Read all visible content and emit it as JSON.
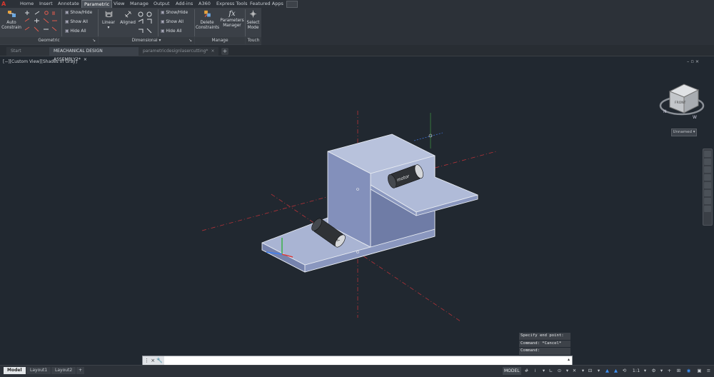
{
  "menu": {
    "logo": "A",
    "tabs": [
      "Home",
      "Insert",
      "Annotate",
      "Parametric",
      "View",
      "Manage",
      "Output",
      "Add-ins",
      "A360",
      "Express Tools",
      "Featured Apps"
    ],
    "active_tab": "Parametric"
  },
  "ribbon": {
    "geometric": {
      "auto_constrain_line1": "Auto",
      "auto_constrain_line2": "Constrain",
      "show_hide": "Show/Hide",
      "show_all": "Show All",
      "hide_all": "Hide All",
      "panel_label": "Geometric"
    },
    "dimensional": {
      "linear": "Linear",
      "aligned": "Aligned",
      "show_hide": "Show/Hide",
      "show_all": "Show All",
      "hide_all": "Hide All",
      "panel_label": "Dimensional"
    },
    "manage": {
      "delete_line1": "Delete",
      "delete_line2": "Constraints",
      "params_line1": "Parameters",
      "params_line2": "Manager",
      "panel_label": "Manage"
    },
    "touch": {
      "select_line1": "Select",
      "select_line2": "Mode",
      "panel_label": "Touch"
    }
  },
  "doc_tabs": [
    {
      "label": "Start",
      "closable": false
    },
    {
      "label": "MEACHANICAL DESIGN ASSEMBLY2*",
      "closable": true
    },
    {
      "label": "parametricdesignlasercutting*",
      "closable": true
    }
  ],
  "viewport": {
    "label": "[−][Custom View][Shades of Gray]",
    "view_cube_label": "Unnamed",
    "motor_labels": [
      "motor",
      "motor"
    ],
    "compass": {
      "n": "N",
      "w": "W",
      "e": "E",
      "s": "S"
    }
  },
  "command_history": [
    "Specify end point:",
    "Command: *Cancel*",
    "Command:"
  ],
  "command_line": {
    "placeholder": "",
    "prefix": "⊳"
  },
  "layout_tabs": [
    "Model",
    "Layout1",
    "Layout2"
  ],
  "active_layout": "Model",
  "status": {
    "model_label": "MODEL",
    "scale": "1:1"
  }
}
